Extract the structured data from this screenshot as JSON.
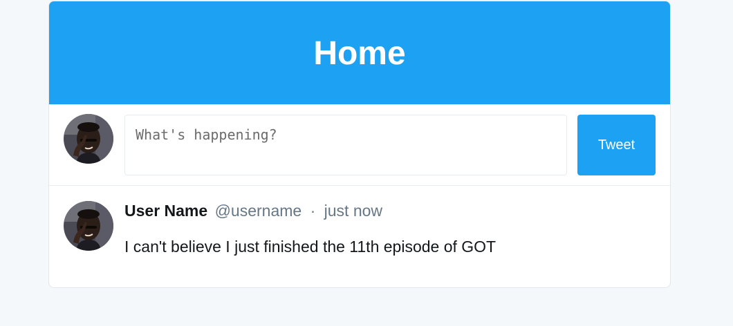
{
  "header": {
    "title": "Home"
  },
  "composer": {
    "avatar_icon": "user-avatar-icon",
    "placeholder": "What's happening?",
    "value": "",
    "button_label": "Tweet"
  },
  "feed": {
    "tweets": [
      {
        "avatar_icon": "user-avatar-icon",
        "name": "User Name",
        "handle": "@username",
        "separator": "·",
        "time": "just now",
        "text": "I can't believe I just finished the 11th episode of GOT"
      }
    ]
  },
  "colors": {
    "brand": "#1da1f2",
    "page_background": "#f5f8fa",
    "secondary_text": "#657786"
  }
}
